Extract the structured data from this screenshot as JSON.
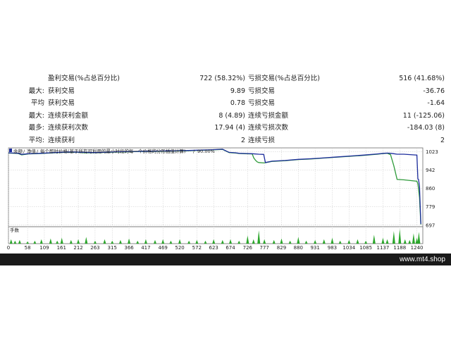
{
  "stats": [
    {
      "prefix": "",
      "label1": "盈利交易(%占总百分比)",
      "value1": "722 (58.32%)",
      "label2": "亏损交易(%占总百分比)",
      "value2": "516 (41.68%)"
    },
    {
      "prefix": "最大:",
      "label1": "获利交易",
      "value1": "9.89",
      "label2": "亏损交易",
      "value2": "-36.76"
    },
    {
      "prefix": "平均",
      "label1": "获利交易",
      "value1": "0.78",
      "label2": "亏损交易",
      "value2": "-1.64"
    },
    {
      "prefix": "最大:",
      "label1": "连续获利金额",
      "value1": "8 (4.89)",
      "label2": "连续亏损金额",
      "value2": "11 (-125.06)"
    },
    {
      "prefix": "最多:",
      "label1": "连续获利次数",
      "value1": "17.94 (4)",
      "label2": "连续亏损次数",
      "value2": "-184.03 (8)"
    },
    {
      "prefix": "平均:",
      "label1": "连续获利",
      "value1": "2",
      "label2": "连续亏损",
      "value2": "2"
    }
  ],
  "chart": {
    "legend_balance": "余额",
    "legend_equity": "净值",
    "legend_text": "每个即时价格(基于所有可利用的最小时段的每一个价格的分形插值计算)",
    "legend_quality": "90.00%",
    "volume_label": "手数",
    "colors": {
      "balance": "#1c2c9c",
      "equity": "#2e9a3a",
      "grid": "#c8c8c8",
      "volume": "#2aa52a"
    }
  },
  "chart_data": {
    "type": "line",
    "title": "",
    "xlabel": "",
    "ylabel": "",
    "x_ticks": [
      0,
      58,
      109,
      161,
      212,
      263,
      315,
      366,
      417,
      469,
      520,
      572,
      623,
      674,
      726,
      777,
      829,
      880,
      931,
      983,
      1034,
      1085,
      1137,
      1188,
      1240
    ],
    "y_ticks": [
      1023,
      942,
      860,
      779,
      697
    ],
    "xlim": [
      0,
      1258
    ],
    "ylim": [
      690,
      1040
    ],
    "series": [
      {
        "name": "余额",
        "x": [
          0,
          30,
          40,
          60,
          100,
          140,
          180,
          210,
          230,
          260,
          300,
          340,
          380,
          420,
          460,
          500,
          540,
          580,
          620,
          650,
          670,
          690,
          700,
          720,
          740,
          760,
          775,
          780,
          800,
          840,
          880,
          920,
          960,
          1000,
          1040,
          1080,
          1120,
          1140,
          1150,
          1160,
          1170,
          1180,
          1200,
          1220,
          1240,
          1243,
          1245,
          1248,
          1252
        ],
        "y": [
          1018,
          1016,
          1011,
          1014,
          1016,
          1019,
          1022,
          1021,
          1020,
          1019,
          1021,
          1023,
          1024,
          1025,
          1026,
          1027,
          1028,
          1030,
          1032,
          1034,
          1020,
          1018,
          1016,
          1015,
          1014,
          1012,
          1011,
          975,
          981,
          984,
          989,
          992,
          996,
          1000,
          1004,
          1008,
          1013,
          1016,
          1017,
          1016,
          1014,
          1012,
          1012,
          1010,
          1008,
          902,
          900,
          870,
          702
        ]
      },
      {
        "name": "净值",
        "x": [
          0,
          30,
          40,
          60,
          100,
          140,
          180,
          210,
          230,
          260,
          300,
          340,
          380,
          420,
          460,
          500,
          540,
          580,
          620,
          650,
          670,
          690,
          700,
          720,
          740,
          745,
          750,
          755,
          760,
          775,
          780,
          800,
          840,
          880,
          920,
          960,
          1000,
          1040,
          1080,
          1120,
          1140,
          1150,
          1160,
          1170,
          1180,
          1200,
          1220,
          1240,
          1243,
          1245,
          1248,
          1252
        ],
        "y": [
          1017,
          1015,
          1009,
          1013,
          1015,
          1018,
          1021,
          1020,
          1018,
          1018,
          1020,
          1022,
          1023,
          1024,
          1025,
          1026,
          1027,
          1029,
          1031,
          1033,
          1019,
          1017,
          1015,
          1014,
          1013,
          995,
          985,
          978,
          975,
          973,
          974,
          980,
          983,
          988,
          991,
          995,
          999,
          1003,
          1007,
          1012,
          1015,
          1016,
          1010,
          960,
          900,
          898,
          895,
          892,
          880,
          860,
          820,
          700
        ]
      }
    ],
    "volume": {
      "x": [
        8,
        20,
        34,
        58,
        80,
        100,
        128,
        148,
        162,
        190,
        212,
        236,
        263,
        292,
        315,
        340,
        366,
        392,
        417,
        445,
        469,
        493,
        520,
        548,
        572,
        598,
        623,
        650,
        674,
        700,
        726,
        744,
        760,
        777,
        806,
        829,
        855,
        880,
        904,
        931,
        958,
        983,
        1007,
        1034,
        1060,
        1085,
        1110,
        1137,
        1150,
        1170,
        1188,
        1204,
        1218,
        1230,
        1240,
        1246
      ],
      "y": [
        0.3,
        0.2,
        0.25,
        0.15,
        0.2,
        0.3,
        0.35,
        0.2,
        0.4,
        0.25,
        0.3,
        0.45,
        0.2,
        0.3,
        0.2,
        0.25,
        0.35,
        0.2,
        0.3,
        0.25,
        0.3,
        0.2,
        0.3,
        0.2,
        0.25,
        0.2,
        0.3,
        0.25,
        0.3,
        0.2,
        0.55,
        0.3,
        0.9,
        0.3,
        0.25,
        0.35,
        0.2,
        0.45,
        0.2,
        0.25,
        0.3,
        0.4,
        0.2,
        0.25,
        0.3,
        0.2,
        0.6,
        0.4,
        0.3,
        0.85,
        1.0,
        0.3,
        0.25,
        0.7,
        0.4,
        0.8
      ]
    },
    "grid": true,
    "legend": "top-left"
  },
  "footer": {
    "watermark": "www.mt4.shop"
  }
}
